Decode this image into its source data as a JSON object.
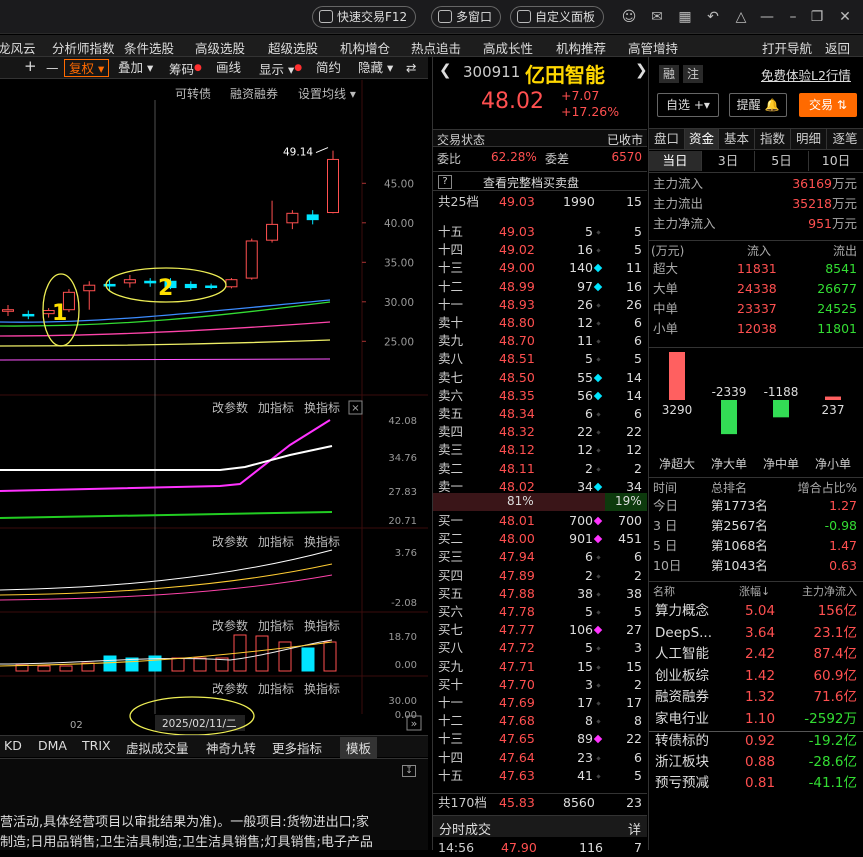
{
  "topbar": {
    "quick_trade": "快速交易F12",
    "multi_window": "多窗口",
    "custom_panel": "自定义面板"
  },
  "menu": [
    "龙风云",
    "分析师指数",
    "条件选股",
    "高级选股",
    "超级选股",
    "机构增仓",
    "热点追击",
    "高成长性",
    "机构推荐",
    "高管增持",
    "打开导航",
    "返回"
  ],
  "toolbar": {
    "plus": "+",
    "minus": "—",
    "fuquan": "复权",
    "overlay": "叠加",
    "chips": "筹码",
    "draw": "画线",
    "display": "显示",
    "simple": "简约",
    "hide": "隐藏"
  },
  "chart_header": {
    "convertible": "可转债",
    "margin": "融资融券",
    "ma_setting": "设置均线"
  },
  "chart_data": [
    {
      "type": "candlestick",
      "name": "main",
      "ylim": [
        22,
        52
      ],
      "yticks": [
        "45.00",
        "40.00",
        "35.00",
        "30.00",
        "25.00"
      ],
      "high_label": "49.14",
      "candles": [
        {
          "o": 29.0,
          "h": 29.6,
          "l": 28.2,
          "c": 28.8,
          "up": true
        },
        {
          "o": 28.4,
          "h": 28.9,
          "l": 27.8,
          "c": 28.4,
          "up": false
        },
        {
          "o": 28.5,
          "h": 29.2,
          "l": 28.0,
          "c": 28.9,
          "up": true
        },
        {
          "o": 29.0,
          "h": 31.6,
          "l": 28.7,
          "c": 31.2,
          "up": true
        },
        {
          "o": 31.4,
          "h": 32.6,
          "l": 29.0,
          "c": 32.1,
          "up": true
        },
        {
          "o": 32.0,
          "h": 32.8,
          "l": 31.4,
          "c": 32.2,
          "up": false
        },
        {
          "o": 32.4,
          "h": 33.4,
          "l": 31.8,
          "c": 32.8,
          "up": true
        },
        {
          "o": 32.6,
          "h": 33.0,
          "l": 31.9,
          "c": 32.4,
          "up": false
        },
        {
          "o": 32.6,
          "h": 33.0,
          "l": 31.6,
          "c": 31.8,
          "up": false
        },
        {
          "o": 31.8,
          "h": 32.6,
          "l": 31.5,
          "c": 32.2,
          "up": false
        },
        {
          "o": 32.0,
          "h": 32.3,
          "l": 31.6,
          "c": 32.0,
          "up": false
        },
        {
          "o": 31.9,
          "h": 33.0,
          "l": 31.7,
          "c": 32.8,
          "up": true
        },
        {
          "o": 33.0,
          "h": 38.0,
          "l": 32.8,
          "c": 37.7,
          "up": true
        },
        {
          "o": 37.8,
          "h": 42.8,
          "l": 37.5,
          "c": 39.8,
          "up": true
        },
        {
          "o": 40.0,
          "h": 41.6,
          "l": 39.2,
          "c": 41.2,
          "up": true
        },
        {
          "o": 41.0,
          "h": 41.6,
          "l": 39.8,
          "c": 40.4,
          "up": false
        },
        {
          "o": 41.3,
          "h": 49.14,
          "l": 41.2,
          "c": 48.02,
          "up": true
        }
      ]
    },
    {
      "type": "line",
      "name": "indicator1",
      "yticks": [
        "42.08",
        "34.76",
        "27.83",
        "20.71"
      ]
    },
    {
      "type": "line",
      "name": "indicator2",
      "yticks": [
        "3.76",
        "-2.08"
      ]
    },
    {
      "type": "bar",
      "name": "volume",
      "yticks": [
        "18.70",
        "0.00"
      ]
    },
    {
      "type": "line",
      "name": "indicator4",
      "yticks": [
        "30.00",
        "0.00"
      ]
    }
  ],
  "panel_controls": {
    "change_param": "改参数",
    "add_ind": "加指标",
    "switch_ind": "换指标"
  },
  "annotations": {
    "one": "1",
    "two": "2"
  },
  "date_label": "2025/02/11/二",
  "x_tick": "02",
  "ind_tabs": [
    "KD",
    "DMA",
    "TRIX",
    "虚拟成交量",
    "神奇九转",
    "更多指标",
    "模板"
  ],
  "bottom_text": [
    "营活动,具体经营项目以审批结果为准)。一般项目:货物进出口;家",
    "制造;日用品销售;卫生洁具制造;卫生洁具销售;灯具销售;电子产品"
  ],
  "stock": {
    "code": "300911",
    "name": "亿田智能",
    "price": "48.02",
    "change": "+7.07",
    "pct": "+17.26%",
    "badge1": "融",
    "badge2": "注",
    "l2": "免费体验L2行情",
    "watch": "自选",
    "alert": "提醒",
    "trade": "交易"
  },
  "status": {
    "label": "交易状态",
    "value": "已收市",
    "wb_label": "委比",
    "wb": "62.28%",
    "wc_label": "委差",
    "wc": "6570",
    "full_book": "查看完整档买卖盘"
  },
  "ask_total": {
    "label": "共25档",
    "price": "49.03",
    "vol": "1990",
    "cnt": "15"
  },
  "asks": [
    {
      "lv": "十五",
      "p": "49.03",
      "v": "5",
      "c": "5",
      "d": ""
    },
    {
      "lv": "十四",
      "p": "49.02",
      "v": "16",
      "c": "5",
      "d": ""
    },
    {
      "lv": "十三",
      "p": "49.00",
      "v": "140",
      "c": "11",
      "d": "c"
    },
    {
      "lv": "十二",
      "p": "48.99",
      "v": "97",
      "c": "16",
      "d": "c"
    },
    {
      "lv": "十一",
      "p": "48.93",
      "v": "26",
      "c": "26",
      "d": ""
    },
    {
      "lv": "卖十",
      "p": "48.80",
      "v": "12",
      "c": "6",
      "d": ""
    },
    {
      "lv": "卖九",
      "p": "48.70",
      "v": "11",
      "c": "6",
      "d": ""
    },
    {
      "lv": "卖八",
      "p": "48.51",
      "v": "5",
      "c": "5",
      "d": ""
    },
    {
      "lv": "卖七",
      "p": "48.50",
      "v": "55",
      "c": "14",
      "d": "c"
    },
    {
      "lv": "卖六",
      "p": "48.35",
      "v": "56",
      "c": "14",
      "d": "c"
    },
    {
      "lv": "卖五",
      "p": "48.34",
      "v": "6",
      "c": "6",
      "d": ""
    },
    {
      "lv": "卖四",
      "p": "48.32",
      "v": "22",
      "c": "22",
      "d": ""
    },
    {
      "lv": "卖三",
      "p": "48.12",
      "v": "12",
      "c": "12",
      "d": ""
    },
    {
      "lv": "卖二",
      "p": "48.11",
      "v": "2",
      "c": "2",
      "d": ""
    },
    {
      "lv": "卖一",
      "p": "48.02",
      "v": "34",
      "c": "34",
      "d": "c"
    }
  ],
  "ratio": {
    "buy": "81%",
    "sell": "19%"
  },
  "bids": [
    {
      "lv": "买一",
      "p": "48.01",
      "v": "700",
      "c": "700",
      "d": "m"
    },
    {
      "lv": "买二",
      "p": "48.00",
      "v": "901",
      "c": "451",
      "d": "m"
    },
    {
      "lv": "买三",
      "p": "47.94",
      "v": "6",
      "c": "6",
      "d": ""
    },
    {
      "lv": "买四",
      "p": "47.89",
      "v": "2",
      "c": "2",
      "d": ""
    },
    {
      "lv": "买五",
      "p": "47.88",
      "v": "38",
      "c": "38",
      "d": ""
    },
    {
      "lv": "买六",
      "p": "47.78",
      "v": "5",
      "c": "5",
      "d": ""
    },
    {
      "lv": "买七",
      "p": "47.77",
      "v": "106",
      "c": "27",
      "d": "m"
    },
    {
      "lv": "买八",
      "p": "47.72",
      "v": "5",
      "c": "3",
      "d": ""
    },
    {
      "lv": "买九",
      "p": "47.71",
      "v": "15",
      "c": "15",
      "d": ""
    },
    {
      "lv": "买十",
      "p": "47.70",
      "v": "3",
      "c": "2",
      "d": ""
    },
    {
      "lv": "十一",
      "p": "47.69",
      "v": "17",
      "c": "17",
      "d": ""
    },
    {
      "lv": "十二",
      "p": "47.68",
      "v": "8",
      "c": "8",
      "d": ""
    },
    {
      "lv": "十三",
      "p": "47.65",
      "v": "89",
      "c": "22",
      "d": "m"
    },
    {
      "lv": "十四",
      "p": "47.64",
      "v": "23",
      "c": "6",
      "d": ""
    },
    {
      "lv": "十五",
      "p": "47.63",
      "v": "41",
      "c": "5",
      "d": ""
    }
  ],
  "bid_total": {
    "label": "共170档",
    "price": "45.83",
    "vol": "8560",
    "cnt": "23"
  },
  "tick_header": {
    "label": "分时成交",
    "detail": "详"
  },
  "last_tick": {
    "time": "14:56",
    "price": "47.90",
    "vol": "116",
    "cnt": "7"
  },
  "right_tabs": [
    "盘口",
    "资金",
    "基本",
    "指数",
    "明细",
    "逐笔"
  ],
  "period_tabs": [
    "当日",
    "3日",
    "5日",
    "10日"
  ],
  "flows": [
    {
      "label": "主力流入",
      "value": "36169",
      "unit": "万元"
    },
    {
      "label": "主力流出",
      "value": "35218",
      "unit": "万元"
    },
    {
      "label": "主力净流入",
      "value": "951",
      "unit": "万元"
    }
  ],
  "flow_table": {
    "unit": "(万元)",
    "in": "流入",
    "out": "流出",
    "rows": [
      {
        "k": "超大",
        "in": "11831",
        "out": "8541"
      },
      {
        "k": "大单",
        "in": "24338",
        "out": "26677"
      },
      {
        "k": "中单",
        "in": "23337",
        "out": "24525"
      },
      {
        "k": "小单",
        "in": "12038",
        "out": "11801"
      }
    ]
  },
  "net_bars": {
    "values": [
      3290,
      -2339,
      -1188,
      237
    ],
    "labels": [
      "3290",
      "-2339",
      "-1188",
      "237"
    ],
    "names": [
      "净超大",
      "净大单",
      "净中单",
      "净小单"
    ]
  },
  "rank": {
    "h1": "时间",
    "h2": "总排名",
    "h3": "增合占比%",
    "rows": [
      {
        "t": "今日",
        "r": "第1773名",
        "p": "1.27"
      },
      {
        "t": "3 日",
        "r": "第2567名",
        "p": "-0.98"
      },
      {
        "t": "5 日",
        "r": "第1068名",
        "p": "1.47"
      },
      {
        "t": "10日",
        "r": "第1043名",
        "p": "0.63"
      }
    ]
  },
  "sectors": {
    "h1": "名称",
    "h2": "涨幅",
    "h3": "主力净流入",
    "rows": [
      {
        "n": "算力概念",
        "z": "5.04",
        "f": "156亿"
      },
      {
        "n": "DeepS...",
        "z": "3.64",
        "f": "23.1亿"
      },
      {
        "n": "人工智能",
        "z": "2.42",
        "f": "87.4亿"
      },
      {
        "n": "创业板综",
        "z": "1.42",
        "f": "60.9亿"
      },
      {
        "n": "融资融券",
        "z": "1.32",
        "f": "71.6亿"
      },
      {
        "n": "家电行业",
        "z": "1.10",
        "f": "-2592万"
      },
      {
        "n": "转债标的",
        "z": "0.92",
        "f": "-19.2亿"
      },
      {
        "n": "浙江板块",
        "z": "0.88",
        "f": "-28.6亿"
      },
      {
        "n": "预亏预减",
        "z": "0.81",
        "f": "-41.1亿"
      }
    ]
  },
  "colors": {
    "up": "#ff5050",
    "down": "#33dd33",
    "cyan": "#00e5ff",
    "magenta": "#ff33ff",
    "orange": "#ff6a00"
  }
}
